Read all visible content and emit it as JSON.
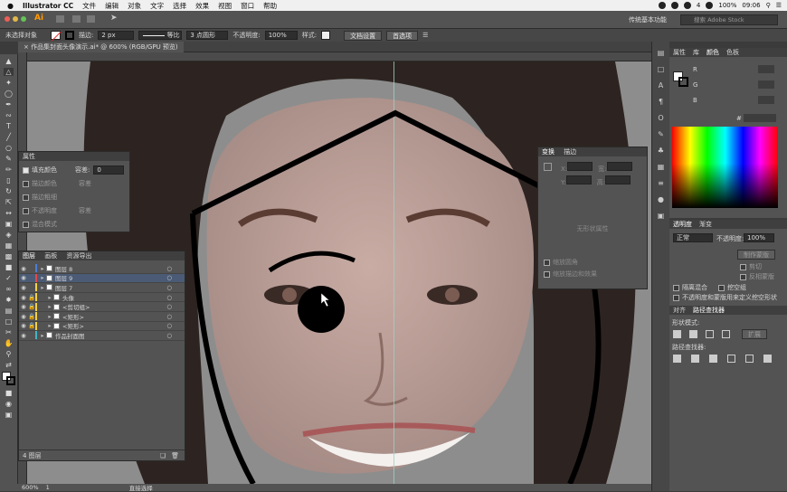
{
  "menubar": {
    "apple": "",
    "app": "Illustrator CC",
    "items": [
      "文件",
      "编辑",
      "对象",
      "文字",
      "选择",
      "效果",
      "视图",
      "窗口",
      "帮助"
    ],
    "tray": {
      "count": "4",
      "battery": "100%",
      "time": "09:06"
    }
  },
  "appbar": {
    "workspace": "传统基本功能",
    "search_placeholder": "搜索 Adobe Stock"
  },
  "control": {
    "selection": "未选择对象",
    "stroke_label": "描边:",
    "stroke_value": "2 px",
    "profile": "等比",
    "brush": "3 点圆形",
    "opacity_label": "不透明度:",
    "opacity_value": "100%",
    "style_label": "样式:",
    "doc_setup": "文档设置",
    "prefs": "首选项"
  },
  "document": {
    "tab": "作品集封面头像演示.ai* @ 600% (RGB/GPU 预览)"
  },
  "status": {
    "zoom": "600%",
    "artboard": "1",
    "tool": "直接选择"
  },
  "appearance": {
    "tab": "属性",
    "fill": "填充颜色",
    "tolerance_label": "容差:",
    "tolerance_value": "0",
    "stroke_color": "描边颜色",
    "stroke_tol": "容差",
    "stroke_weight": "描边粗细",
    "opacity": "不透明度",
    "opacity_tol": "容差",
    "blend": "混合模式"
  },
  "layers": {
    "tabs": [
      "图层",
      "画板",
      "资源导出"
    ],
    "rows": [
      {
        "name": "图层 8",
        "color": "#4e7ed8",
        "indent": 0,
        "selected": false
      },
      {
        "name": "图层 9",
        "color": "#e24848",
        "indent": 0,
        "selected": true
      },
      {
        "name": "图层 7",
        "color": "#f2d24a",
        "indent": 0,
        "selected": false
      },
      {
        "name": "头像",
        "color": "#f2d24a",
        "indent": 1,
        "selected": false
      },
      {
        "name": "<剪切组>",
        "color": "#f2d24a",
        "indent": 1,
        "selected": false
      },
      {
        "name": "<矩形>",
        "color": "#f2d24a",
        "indent": 1,
        "selected": false
      },
      {
        "name": "<矩形>",
        "color": "#f2d24a",
        "indent": 1,
        "selected": false
      },
      {
        "name": "作品封面图",
        "color": "#43b5c6",
        "indent": 0,
        "selected": false
      }
    ],
    "count": "4 图层"
  },
  "transform": {
    "tabs": [
      "变换",
      "描边"
    ],
    "x": "X:",
    "y": "Y:",
    "w": "宽:",
    "h": "高:",
    "empty": "无形状属性",
    "scale_corners": "缩放圆角",
    "scale_strokes": "缩放描边和效果"
  },
  "color": {
    "tabs": [
      "属性",
      "库",
      "颜色",
      "色板"
    ],
    "r": "R",
    "g": "G",
    "b": "B",
    "hash": "#"
  },
  "transparency": {
    "tabs": [
      "透明度",
      "渐变"
    ],
    "mode": "正常",
    "opacity_label": "不透明度:",
    "opacity_value": "100%",
    "make_mask": "制作蒙版",
    "clip": "剪切",
    "invert": "反相蒙版",
    "isolate": "隔离混合",
    "knockout": "挖空组",
    "define": "不透明度和蒙版用来定义挖空形状"
  },
  "pathfinder": {
    "tabs": [
      "对齐",
      "路径查找器"
    ],
    "shape_modes": "形状模式:",
    "expand": "扩展",
    "pathfinders": "路径查找器:"
  },
  "colors": {
    "accent": "#4b5b75",
    "panel": "#535353",
    "dark": "#3b3b3b"
  }
}
